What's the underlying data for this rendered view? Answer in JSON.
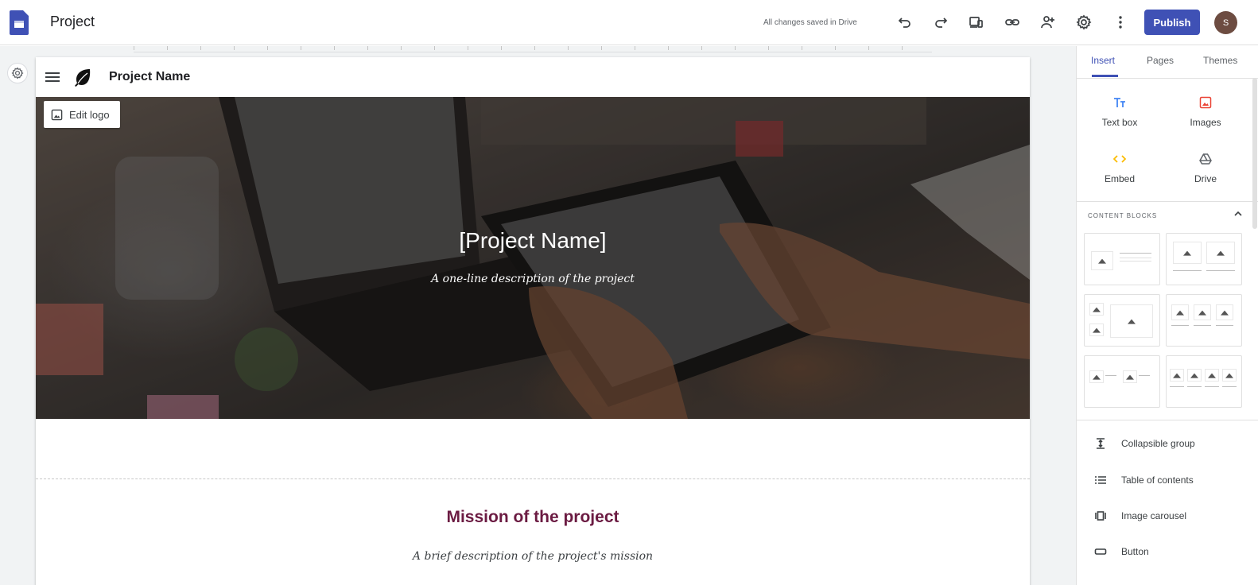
{
  "app": {
    "title": "Project",
    "save_status": "All changes saved in Drive",
    "publish_label": "Publish",
    "avatar_initial": "S",
    "brand_color": "#3f51b5",
    "toolbar_icons": [
      "undo-icon",
      "redo-icon",
      "preview-icon",
      "link-icon",
      "share-icon",
      "settings-icon",
      "more-icon"
    ]
  },
  "site": {
    "name": "Project Name",
    "edit_logo_label": "Edit logo",
    "hero_title": "[Project Name]",
    "hero_subtitle": "A one-line description of the project",
    "mission_title": "Mission of the project",
    "mission_desc": "A brief description of the project's mission",
    "mission_color": "#6b1b42"
  },
  "panel": {
    "tabs": [
      {
        "label": "Insert",
        "active": true
      },
      {
        "label": "Pages",
        "active": false
      },
      {
        "label": "Themes",
        "active": false
      }
    ],
    "tools": [
      {
        "label": "Text box",
        "icon": "text-box-icon",
        "color": "#4285f4"
      },
      {
        "label": "Images",
        "icon": "image-icon",
        "color": "#ea4335"
      },
      {
        "label": "Embed",
        "icon": "embed-icon",
        "color": "#fbbc04"
      },
      {
        "label": "Drive",
        "icon": "drive-icon",
        "color": "#5f6368"
      }
    ],
    "content_blocks_label": "CONTENT BLOCKS",
    "list_items": [
      {
        "label": "Collapsible group",
        "icon": "collapsible-icon"
      },
      {
        "label": "Table of contents",
        "icon": "toc-icon"
      },
      {
        "label": "Image carousel",
        "icon": "carousel-icon"
      },
      {
        "label": "Button",
        "icon": "button-icon"
      }
    ]
  }
}
